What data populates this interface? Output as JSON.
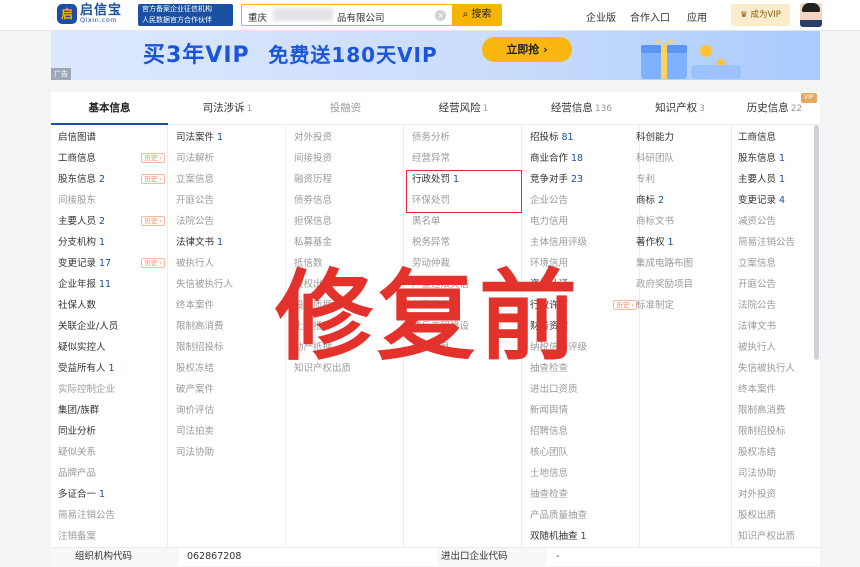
{
  "header": {
    "logo_glyph": "启",
    "logo_cn": "启信宝",
    "logo_en": "Qixin.com",
    "slogan_line1": "官方备案企业征信机构",
    "slogan_line2": "人民数据官方合作伙伴",
    "search_prefix": "重庆",
    "search_suffix": "品有限公司",
    "search_button": "搜索",
    "nav": [
      "企业版",
      "合作入口",
      "应用"
    ],
    "vip_button": "成为VIP",
    "accent_color": "#f5b400",
    "brand_color": "#1a4fa3"
  },
  "banner": {
    "text_main": "买3年VIP",
    "text_sub": "免费送180天VIP",
    "cta": "立即抢 ›",
    "ad_label": "广告"
  },
  "tabs": [
    {
      "label": "基本信息",
      "count": ""
    },
    {
      "label": "司法涉诉",
      "count": "1"
    },
    {
      "label": "投融资",
      "count": ""
    },
    {
      "label": "经营风险",
      "count": "1"
    },
    {
      "label": "经营信息",
      "count": "136"
    },
    {
      "label": "知识产权",
      "count": "3"
    },
    {
      "label": "历史信息",
      "count": "22"
    }
  ],
  "vip_tag": "VIP",
  "history_tag": "历史 ›",
  "columns": [
    [
      {
        "label": "启信图谱",
        "count": "",
        "gray": false,
        "hist": false
      },
      {
        "label": "工商信息",
        "count": "",
        "gray": false,
        "hist": true
      },
      {
        "label": "股东信息",
        "count": "2",
        "gray": false,
        "hist": true
      },
      {
        "label": "间接股东",
        "count": "",
        "gray": true,
        "hist": false
      },
      {
        "label": "主要人员",
        "count": "2",
        "gray": false,
        "hist": true
      },
      {
        "label": "分支机构",
        "count": "1",
        "gray": false,
        "hist": false
      },
      {
        "label": "变更记录",
        "count": "17",
        "gray": false,
        "hist": true
      },
      {
        "label": "企业年报",
        "count": "11",
        "gray": false,
        "hist": false
      },
      {
        "label": "社保人数",
        "count": "",
        "gray": false,
        "hist": false
      },
      {
        "label": "关联企业/人员",
        "count": "",
        "gray": false,
        "hist": false
      },
      {
        "label": "疑似实控人",
        "count": "",
        "gray": false,
        "hist": false
      },
      {
        "label": "受益所有人",
        "count": "1",
        "gray": false,
        "hist": false
      },
      {
        "label": "实际控制企业",
        "count": "",
        "gray": true,
        "hist": false
      },
      {
        "label": "集团/族群",
        "count": "",
        "gray": false,
        "hist": false
      },
      {
        "label": "同业分析",
        "count": "",
        "gray": false,
        "hist": false
      },
      {
        "label": "疑似关系",
        "count": "",
        "gray": true,
        "hist": false
      },
      {
        "label": "品牌产品",
        "count": "",
        "gray": true,
        "hist": false
      },
      {
        "label": "多证合一",
        "count": "1",
        "gray": false,
        "hist": false
      },
      {
        "label": "简易注销公告",
        "count": "",
        "gray": true,
        "hist": false
      },
      {
        "label": "注销备案",
        "count": "",
        "gray": true,
        "hist": false
      }
    ],
    [
      {
        "label": "司法案件",
        "count": "1",
        "gray": false,
        "hist": false
      },
      {
        "label": "司法解析",
        "count": "",
        "gray": true,
        "hist": false
      },
      {
        "label": "立案信息",
        "count": "",
        "gray": true,
        "hist": false
      },
      {
        "label": "开庭公告",
        "count": "",
        "gray": true,
        "hist": false
      },
      {
        "label": "法院公告",
        "count": "",
        "gray": true,
        "hist": false
      },
      {
        "label": "法律文书",
        "count": "1",
        "gray": false,
        "hist": false
      },
      {
        "label": "被执行人",
        "count": "",
        "gray": true,
        "hist": false
      },
      {
        "label": "失信被执行人",
        "count": "",
        "gray": true,
        "hist": false
      },
      {
        "label": "终本案件",
        "count": "",
        "gray": true,
        "hist": false
      },
      {
        "label": "限制高消费",
        "count": "",
        "gray": true,
        "hist": false
      },
      {
        "label": "限制招投标",
        "count": "",
        "gray": true,
        "hist": false
      },
      {
        "label": "股权冻结",
        "count": "",
        "gray": true,
        "hist": false
      },
      {
        "label": "破产案件",
        "count": "",
        "gray": true,
        "hist": false
      },
      {
        "label": "询价评估",
        "count": "",
        "gray": true,
        "hist": false
      },
      {
        "label": "司法拍卖",
        "count": "",
        "gray": true,
        "hist": false
      },
      {
        "label": "司法协助",
        "count": "",
        "gray": true,
        "hist": false
      }
    ],
    [
      {
        "label": "对外投资",
        "count": "",
        "gray": true,
        "hist": false
      },
      {
        "label": "间接投资",
        "count": "",
        "gray": true,
        "hist": false
      },
      {
        "label": "融资历程",
        "count": "",
        "gray": true,
        "hist": false
      },
      {
        "label": "债券信息",
        "count": "",
        "gray": true,
        "hist": false
      },
      {
        "label": "担保信息",
        "count": "",
        "gray": true,
        "hist": false
      },
      {
        "label": "私募基金",
        "count": "",
        "gray": true,
        "hist": false
      },
      {
        "label": "抵信数",
        "count": "",
        "gray": true,
        "hist": false
      },
      {
        "label": "股权出质",
        "count": "",
        "gray": true,
        "hist": false
      },
      {
        "label": "股权质押",
        "count": "",
        "gray": true,
        "hist": false
      },
      {
        "label": "土地抵押",
        "count": "",
        "gray": true,
        "hist": false
      },
      {
        "label": "动产抵押",
        "count": "",
        "gray": true,
        "hist": false
      },
      {
        "label": "知识产权出质",
        "count": "",
        "gray": true,
        "hist": false
      }
    ],
    [
      {
        "label": "债务分析",
        "count": "",
        "gray": true,
        "hist": false
      },
      {
        "label": "经营异常",
        "count": "",
        "gray": true,
        "hist": false
      },
      {
        "label": "行政处罚",
        "count": "1",
        "gray": false,
        "hist": false
      },
      {
        "label": "环保处罚",
        "count": "",
        "gray": true,
        "hist": false
      },
      {
        "label": "黑名单",
        "count": "",
        "gray": true,
        "hist": false
      },
      {
        "label": "税务异常",
        "count": "",
        "gray": true,
        "hist": false
      },
      {
        "label": "劳动仲裁",
        "count": "",
        "gray": true,
        "hist": false
      },
      {
        "label": "严重违法失信",
        "count": "",
        "gray": true,
        "hist": false
      },
      {
        "label": "欠税信息",
        "count": "",
        "gray": true,
        "hist": false
      },
      {
        "label": "违反工程建设",
        "count": "",
        "gray": true,
        "hist": false
      },
      {
        "label": "清算信息",
        "count": "",
        "gray": true,
        "hist": false
      }
    ],
    [
      {
        "label": "招投标",
        "count": "81",
        "gray": false,
        "hist": false
      },
      {
        "label": "商业合作",
        "count": "18",
        "gray": false,
        "hist": false
      },
      {
        "label": "竞争对手",
        "count": "23",
        "gray": false,
        "hist": false
      },
      {
        "label": "企业公告",
        "count": "",
        "gray": true,
        "hist": false
      },
      {
        "label": "电力信用",
        "count": "",
        "gray": true,
        "hist": false
      },
      {
        "label": "主体信用评级",
        "count": "",
        "gray": true,
        "hist": false
      },
      {
        "label": "环境信用",
        "count": "",
        "gray": true,
        "hist": false
      },
      {
        "label": "资质认证",
        "count": "",
        "gray": false,
        "hist": false
      },
      {
        "label": "行政许可",
        "count": "",
        "gray": false,
        "hist": true
      },
      {
        "label": "财务资质",
        "count": "",
        "gray": false,
        "hist": false
      },
      {
        "label": "纳税信用评级",
        "count": "",
        "gray": true,
        "hist": false
      },
      {
        "label": "抽查检查",
        "count": "",
        "gray": true,
        "hist": false
      },
      {
        "label": "进出口资质",
        "count": "",
        "gray": true,
        "hist": false
      },
      {
        "label": "新闻舆情",
        "count": "",
        "gray": true,
        "hist": false
      },
      {
        "label": "招聘信息",
        "count": "",
        "gray": true,
        "hist": false
      },
      {
        "label": "核心团队",
        "count": "",
        "gray": true,
        "hist": false
      },
      {
        "label": "土地信息",
        "count": "",
        "gray": true,
        "hist": false
      },
      {
        "label": "抽查检查",
        "count": "",
        "gray": true,
        "hist": false
      },
      {
        "label": "产品质量抽查",
        "count": "",
        "gray": true,
        "hist": false
      },
      {
        "label": "双随机抽查",
        "count": "1",
        "gray": false,
        "hist": false
      }
    ],
    [
      {
        "label": "科创能力",
        "count": "",
        "gray": false,
        "hist": false
      },
      {
        "label": "科研团队",
        "count": "",
        "gray": true,
        "hist": false
      },
      {
        "label": "专利",
        "count": "",
        "gray": true,
        "hist": false
      },
      {
        "label": "商标",
        "count": "2",
        "gray": false,
        "hist": false
      },
      {
        "label": "商标文书",
        "count": "",
        "gray": true,
        "hist": false
      },
      {
        "label": "著作权",
        "count": "1",
        "gray": false,
        "hist": false
      },
      {
        "label": "集成电路布图",
        "count": "",
        "gray": true,
        "hist": false
      },
      {
        "label": "政府奖励项目",
        "count": "",
        "gray": true,
        "hist": false
      },
      {
        "label": "标准制定",
        "count": "",
        "gray": true,
        "hist": false
      }
    ],
    [
      {
        "label": "工商信息",
        "count": "",
        "gray": false,
        "hist": false
      },
      {
        "label": "股东信息",
        "count": "1",
        "gray": false,
        "hist": false
      },
      {
        "label": "主要人员",
        "count": "1",
        "gray": false,
        "hist": false
      },
      {
        "label": "变更记录",
        "count": "4",
        "gray": false,
        "hist": false
      },
      {
        "label": "减资公告",
        "count": "",
        "gray": true,
        "hist": false
      },
      {
        "label": "简易注销公告",
        "count": "",
        "gray": true,
        "hist": false
      },
      {
        "label": "立案信息",
        "count": "",
        "gray": true,
        "hist": false
      },
      {
        "label": "开庭公告",
        "count": "",
        "gray": true,
        "hist": false
      },
      {
        "label": "法院公告",
        "count": "",
        "gray": true,
        "hist": false
      },
      {
        "label": "法律文书",
        "count": "",
        "gray": true,
        "hist": false
      },
      {
        "label": "被执行人",
        "count": "",
        "gray": true,
        "hist": false
      },
      {
        "label": "失信被执行人",
        "count": "",
        "gray": true,
        "hist": false
      },
      {
        "label": "终本案件",
        "count": "",
        "gray": true,
        "hist": false
      },
      {
        "label": "限制高消费",
        "count": "",
        "gray": true,
        "hist": false
      },
      {
        "label": "限制招投标",
        "count": "",
        "gray": true,
        "hist": false
      },
      {
        "label": "股权冻结",
        "count": "",
        "gray": true,
        "hist": false
      },
      {
        "label": "司法协助",
        "count": "",
        "gray": true,
        "hist": false
      },
      {
        "label": "对外投资",
        "count": "",
        "gray": true,
        "hist": false
      },
      {
        "label": "股权出质",
        "count": "",
        "gray": true,
        "hist": false
      },
      {
        "label": "知识产权出质",
        "count": "",
        "gray": true,
        "hist": false
      }
    ]
  ],
  "stamp_text": "修复前",
  "bottom_row": {
    "label1": "组织机构代码",
    "value1": "062867208",
    "label2": "进出口企业代码",
    "value2": "-"
  }
}
